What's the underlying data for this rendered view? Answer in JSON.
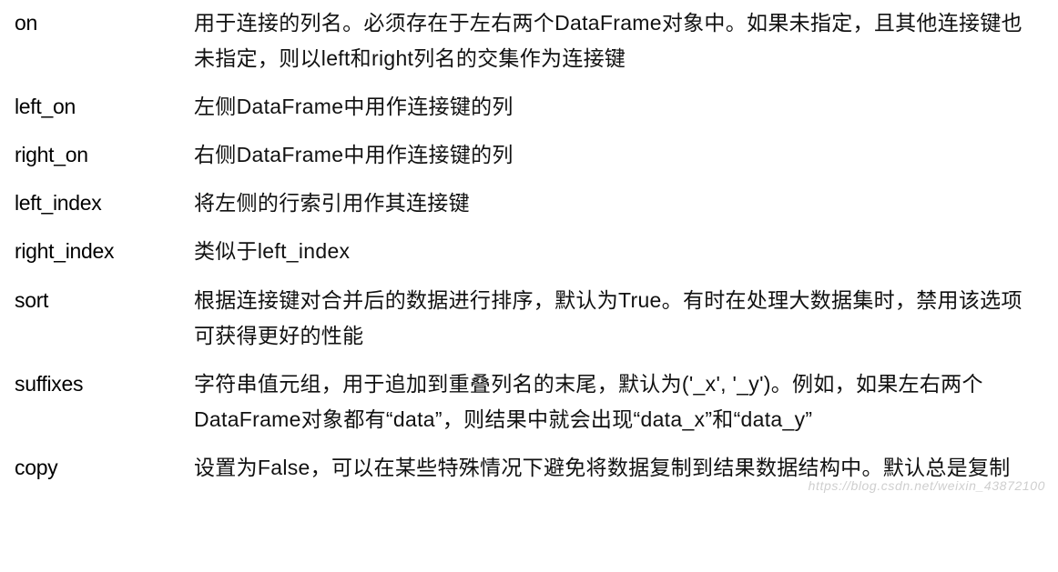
{
  "params": [
    {
      "name": "on",
      "desc": "用于连接的列名。必须存在于左右两个DataFrame对象中。如果未指定，且其他连接键也未指定，则以left和right列名的交集作为连接键"
    },
    {
      "name": "left_on",
      "desc": "左侧DataFrame中用作连接键的列"
    },
    {
      "name": "right_on",
      "desc": "右侧DataFrame中用作连接键的列"
    },
    {
      "name": "left_index",
      "desc": "将左侧的行索引用作其连接键"
    },
    {
      "name": "right_index",
      "desc": "类似于left_index"
    },
    {
      "name": "sort",
      "desc": "根据连接键对合并后的数据进行排序，默认为True。有时在处理大数据集时，禁用该选项可获得更好的性能"
    },
    {
      "name": "suffixes",
      "desc": "字符串值元组，用于追加到重叠列名的末尾，默认为('_x', '_y')。例如，如果左右两个DataFrame对象都有“data”，则结果中就会出现“data_x”和“data_y”"
    },
    {
      "name": "copy",
      "desc": "设置为False，可以在某些特殊情况下避免将数据复制到结果数据结构中。默认总是复制"
    }
  ],
  "watermark": "https://blog.csdn.net/weixin_43872100"
}
